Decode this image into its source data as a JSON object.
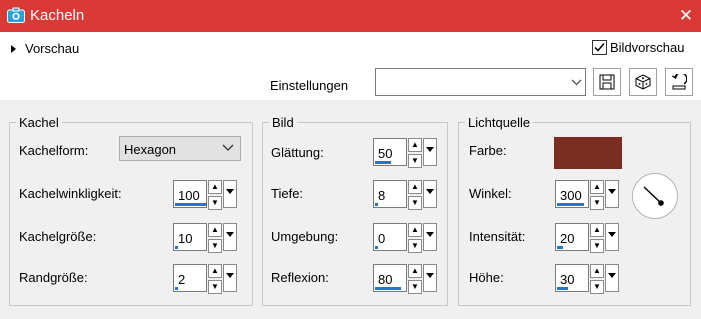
{
  "window": {
    "title": "Kacheln"
  },
  "topbar": {
    "preview_toggle": "Vorschau",
    "bildvorschau": {
      "label": "Bildvorschau",
      "checked": true
    },
    "einstellungen_label": "Einstellungen",
    "einstellungen_value": ""
  },
  "kachel": {
    "legend": "Kachel",
    "form_label": "Kachelform:",
    "form_value": "Hexagon",
    "fields": [
      {
        "label": "Kachelwinkligkeit:",
        "value": "100",
        "level": 1.0
      },
      {
        "label": "Kachelgröße:",
        "value": "10",
        "level": 0.05
      },
      {
        "label": "Randgröße:",
        "value": "2",
        "level": 0.05
      }
    ]
  },
  "bild": {
    "legend": "Bild",
    "fields": [
      {
        "label": "Glättung:",
        "value": "50",
        "level": 0.5
      },
      {
        "label": "Tiefe:",
        "value": "8",
        "level": 0.08
      },
      {
        "label": "Umgebung:",
        "value": "0",
        "level": 0.05
      },
      {
        "label": "Reflexion:",
        "value": "80",
        "level": 0.8
      }
    ]
  },
  "licht": {
    "legend": "Lichtquelle",
    "farbe_label": "Farbe:",
    "farbe_color": "#7b2d22",
    "fields": [
      {
        "label": "Winkel:",
        "value": "300",
        "level": 0.83
      },
      {
        "label": "Intensität:",
        "value": "20",
        "level": 0.2
      },
      {
        "label": "Höhe:",
        "value": "30",
        "level": 0.33
      }
    ]
  },
  "colors": {
    "titlebar": "#d93a36",
    "accent": "#1e78d2"
  }
}
